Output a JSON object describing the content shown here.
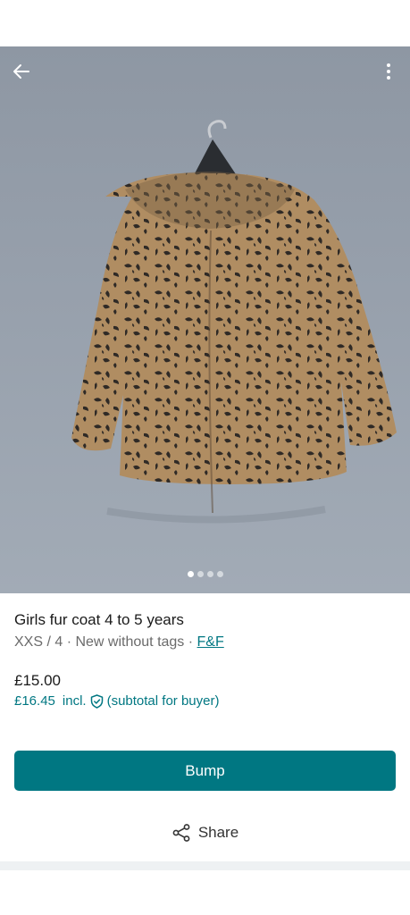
{
  "colors": {
    "accent": "#007782",
    "text_primary": "#1a1a1a",
    "text_secondary": "#6b6b6b",
    "photo_background": "#969fab",
    "footer_strip": "#eef1f3"
  },
  "gallery": {
    "back_icon": "arrow-left-icon",
    "more_icon": "more-vertical-icon",
    "photo_subject": "leopard-print-fur-coat",
    "image_count": 4,
    "active_index": 0
  },
  "item": {
    "title": "Girls fur coat 4 to 5 years",
    "size": "XXS / 4",
    "separator1": " · ",
    "condition": "New without tags",
    "separator2": " · ",
    "brand": "F&F",
    "price": "£15.00",
    "buyer_price": "£16.45",
    "incl_label": "incl.",
    "protection_icon": "shield-check-icon",
    "buyer_note": "(subtotal for buyer)"
  },
  "actions": {
    "bump_label": "Bump",
    "share_label": "Share",
    "share_icon": "share-icon"
  }
}
